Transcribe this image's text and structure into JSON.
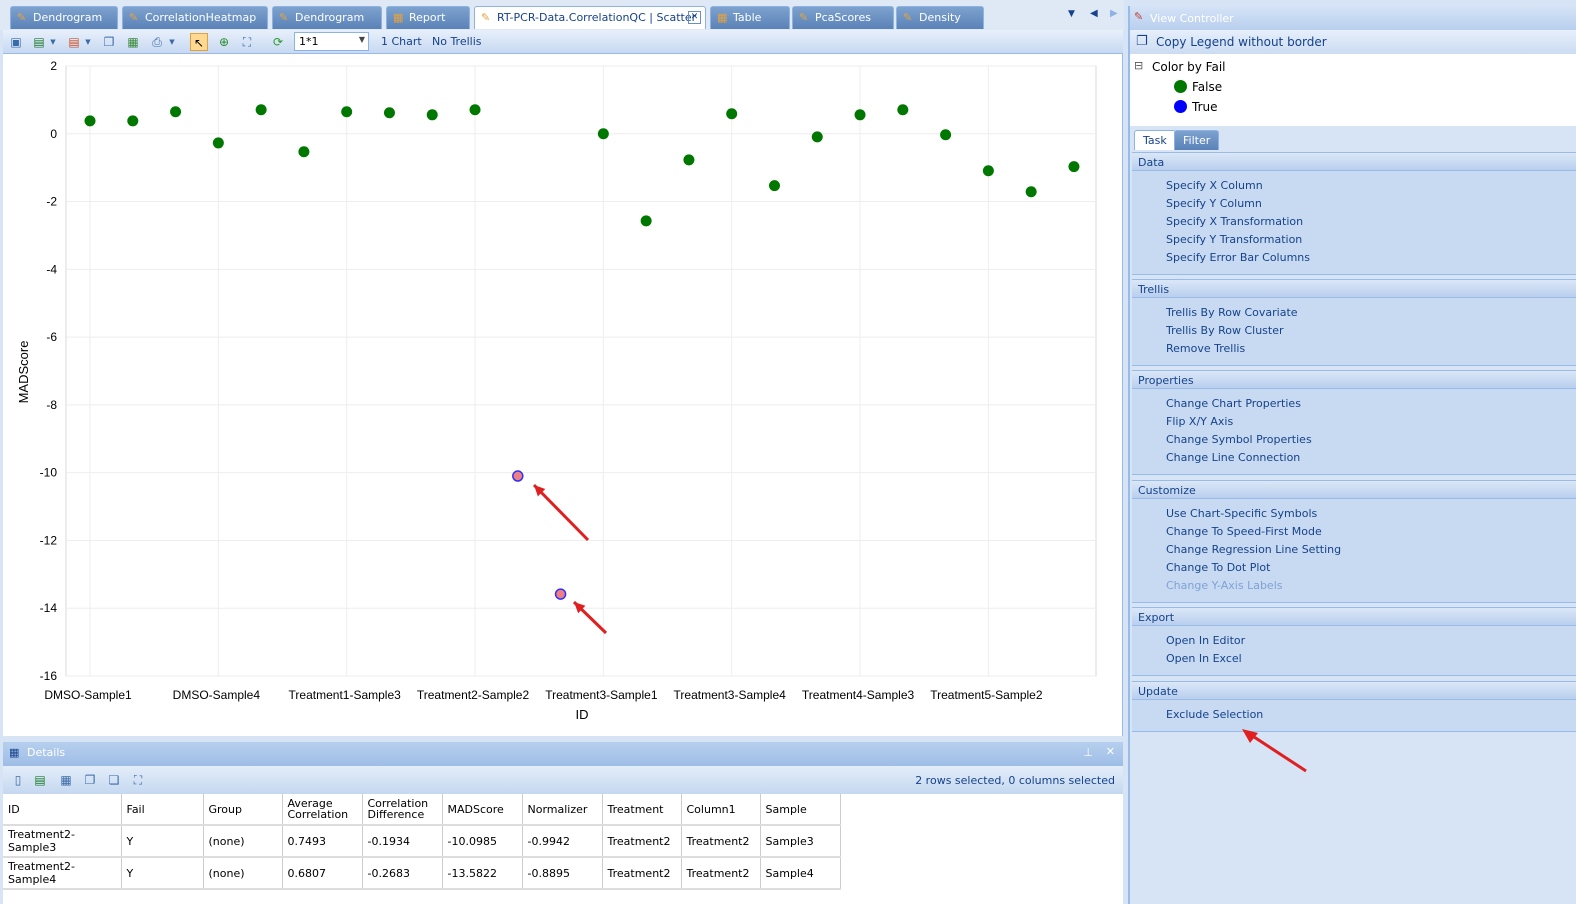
{
  "tabs": [
    {
      "label": "Dendrogram",
      "icon": "pencil-chart-icon"
    },
    {
      "label": "CorrelationHeatmap",
      "icon": "pencil-chart-icon"
    },
    {
      "label": "Dendrogram",
      "icon": "pencil-chart-icon"
    },
    {
      "label": "Report",
      "icon": "report-icon"
    },
    {
      "label": "RT-PCR-Data.CorrelationQC | Scatter",
      "icon": "scatter-icon",
      "active": true
    },
    {
      "label": "Table",
      "icon": "table-icon"
    },
    {
      "label": "PcaScores",
      "icon": "pencil-chart-icon"
    },
    {
      "label": "Density",
      "icon": "pencil-chart-icon"
    }
  ],
  "toolbar": {
    "layout_value": "1*1",
    "chart_count": "1 Chart",
    "trellis": "No Trellis"
  },
  "chart_data": {
    "type": "scatter",
    "xlabel": "ID",
    "ylabel": "MADScore",
    "ylim": [
      -16,
      2
    ],
    "yticks": [
      2,
      0,
      -2,
      -4,
      -6,
      -8,
      -10,
      -12,
      -14,
      -16
    ],
    "grid": true,
    "x_tick_labels": [
      {
        "index": 0,
        "label": "DMSO-Sample1"
      },
      {
        "index": 3,
        "label": "DMSO-Sample4"
      },
      {
        "index": 6,
        "label": "Treatment1-Sample3"
      },
      {
        "index": 9,
        "label": "Treatment2-Sample2"
      },
      {
        "index": 12,
        "label": "Treatment3-Sample1"
      },
      {
        "index": 15,
        "label": "Treatment3-Sample4"
      },
      {
        "index": 18,
        "label": "Treatment4-Sample3"
      },
      {
        "index": 21,
        "label": "Treatment5-Sample2"
      }
    ],
    "point_count": 24,
    "values": [
      0.38,
      0.38,
      0.65,
      -0.27,
      0.71,
      -0.53,
      0.65,
      0.62,
      0.56,
      0.71,
      -10.0985,
      -13.5822,
      0.0,
      -2.57,
      -0.77,
      0.59,
      -1.53,
      -0.09,
      0.56,
      0.71,
      -0.03,
      -1.09,
      -1.71,
      -0.97
    ],
    "fail": [
      false,
      false,
      false,
      false,
      false,
      false,
      false,
      false,
      false,
      false,
      true,
      true,
      false,
      false,
      false,
      false,
      false,
      false,
      false,
      false,
      false,
      false,
      false,
      false
    ],
    "selected": [
      10,
      11
    ],
    "colors": {
      "false": "#007800",
      "true": "#0000ff",
      "selected_fill": "#f08080"
    }
  },
  "details": {
    "title": "Details",
    "status": "2 rows selected, 0 columns selected",
    "columns": [
      "ID",
      "Fail",
      "Group",
      "Average Correlation",
      "Correlation Difference",
      "MADScore",
      "Normalizer",
      "Treatment",
      "Column1",
      "Sample"
    ],
    "rows": [
      [
        "Treatment2-Sample3",
        "Y",
        "(none)",
        "0.7493",
        "-0.1934",
        "-10.0985",
        "-0.9942",
        "Treatment2",
        "Treatment2",
        "Sample3"
      ],
      [
        "Treatment2-Sample4",
        "Y",
        "(none)",
        "0.6807",
        "-0.2683",
        "-13.5822",
        "-0.8895",
        "Treatment2",
        "Treatment2",
        "Sample4"
      ]
    ]
  },
  "view_controller": {
    "title": "View Controller",
    "copy_legend": "Copy Legend  without border",
    "legend_title": "Color by Fail",
    "legend_items": [
      {
        "label": "False",
        "color": "#007800"
      },
      {
        "label": "True",
        "color": "#0000ff"
      }
    ],
    "tabs": [
      "Task",
      "Filter"
    ],
    "sections": [
      {
        "title": "Data",
        "items": [
          "Specify X Column",
          "Specify Y Column",
          "Specify X Transformation",
          "Specify Y Transformation",
          "Specify Error Bar Columns"
        ]
      },
      {
        "title": "Trellis",
        "items": [
          "Trellis By Row Covariate",
          "Trellis By Row Cluster",
          "Remove Trellis"
        ]
      },
      {
        "title": "Properties",
        "items": [
          "Change Chart Properties",
          "Flip X/Y Axis",
          "Change Symbol Properties",
          "Change Line Connection"
        ]
      },
      {
        "title": "Customize",
        "items": [
          "Use Chart-Specific Symbols",
          "Change To Speed-First Mode",
          "Change Regression Line Setting",
          "Change To Dot Plot",
          "Change Y-Axis Labels"
        ],
        "disabled": [
          4
        ]
      },
      {
        "title": "Export",
        "items": [
          "Open In Editor",
          "Open In Excel"
        ]
      },
      {
        "title": "Update",
        "items": [
          "Exclude Selection"
        ]
      }
    ]
  }
}
